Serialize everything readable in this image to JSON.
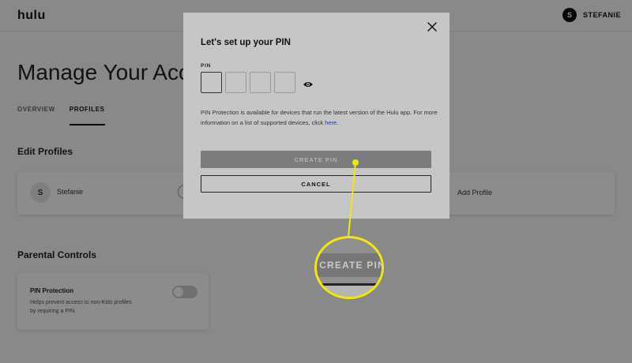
{
  "header": {
    "logo": "hulu",
    "user_initial": "S",
    "user_name": "STEFANIE"
  },
  "page": {
    "title": "Manage Your Acc",
    "tabs": [
      {
        "label": "OVERVIEW"
      },
      {
        "label": "PROFILES"
      }
    ],
    "edit_profiles": {
      "title": "Edit Profiles",
      "profile_initial": "S",
      "profile_name": "Stefanie",
      "add_profile": "Add Profile"
    },
    "parental_controls": {
      "title": "Parental Controls",
      "pin_title": "PIN Protection",
      "pin_desc": "Helps prevent access to non-Kids profiles by requiring a PIN."
    }
  },
  "modal": {
    "title": "Let's set up your PIN",
    "pin_label": "PIN",
    "info_text": "PIN Protection is available for devices that run the latest version of the Hulu app. For more information on a list of supported devices, click ",
    "info_link": "here",
    "info_end": ".",
    "create_label": "CREATE PIN",
    "cancel_label": "CANCEL"
  },
  "callout": {
    "label": "CREATE PIN",
    "color": "#f2e60f"
  },
  "icons": [
    "close-icon",
    "eye-icon"
  ]
}
